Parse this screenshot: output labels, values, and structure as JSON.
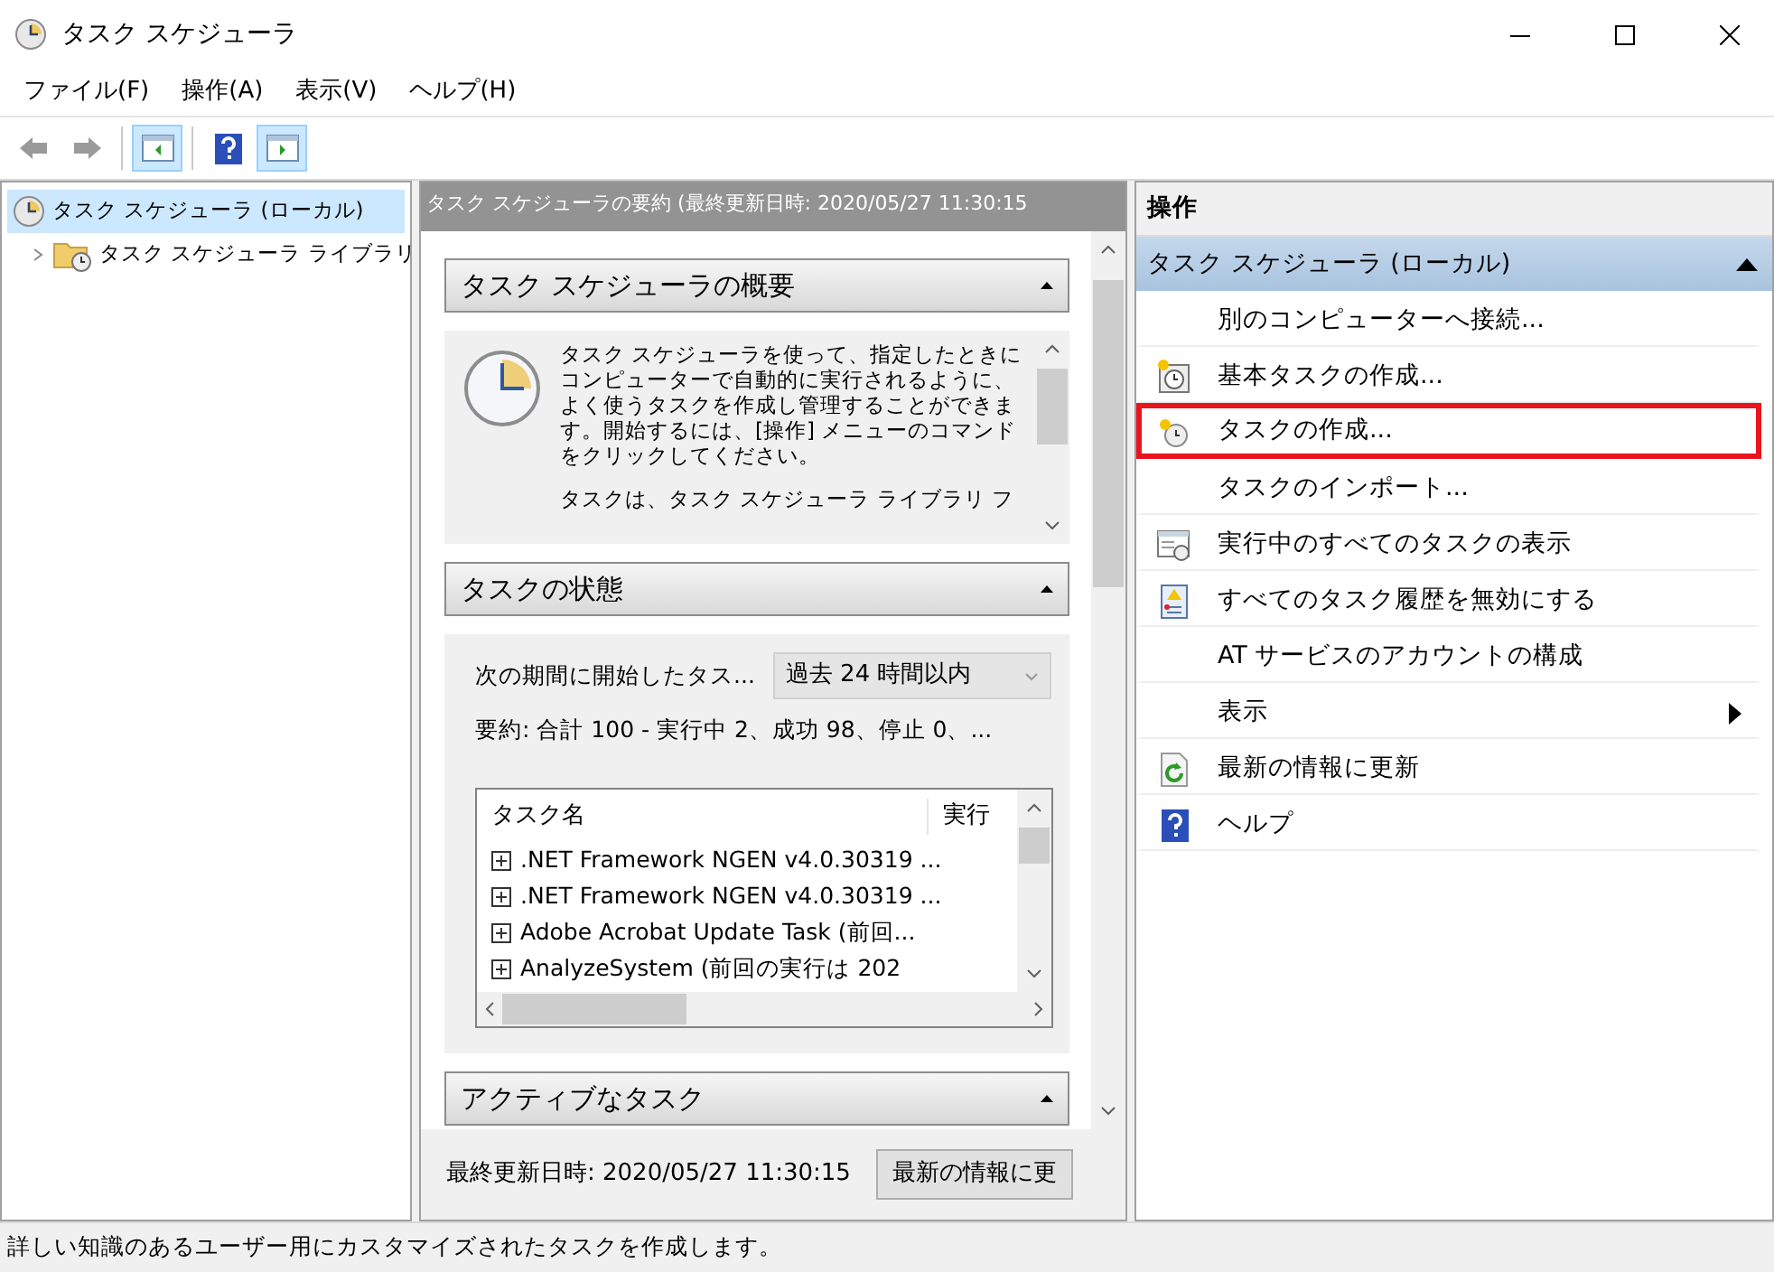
{
  "window": {
    "title": "タスク スケジューラ"
  },
  "menu": [
    {
      "label": "ファイル(F)"
    },
    {
      "label": "操作(A)"
    },
    {
      "label": "表示(V)"
    },
    {
      "label": "ヘルプ(H)"
    }
  ],
  "toolbar": [
    {
      "kind": "back",
      "disabled": true
    },
    {
      "kind": "forward",
      "disabled": true
    },
    {
      "kind": "tree-pane",
      "on": true
    },
    {
      "kind": "help",
      "on": false
    },
    {
      "kind": "action-pane",
      "on": true
    }
  ],
  "tree": [
    {
      "label": "タスク スケジューラ (ローカル)",
      "selected": true,
      "children": [
        {
          "label": "タスク スケジューラ ライブラリ",
          "selected": false,
          "expanded": false
        }
      ]
    }
  ],
  "center": {
    "header": "タスク スケジューラの要約 (最終更新日時: 2020/05/27 11:30:15",
    "sections": [
      {
        "kind": "overview",
        "title": "タスク スケジューラの概要",
        "expanded": true,
        "text": "タスク スケジューラを使って、指定したときにコンピューターで自動的に実行されるように、よく使うタスクを作成し管理することができます。開始するには、[操作] メニューのコマンドをクリックしてください。",
        "text2": "タスクは、タスク スケジューラ ライブラリ フ"
      },
      {
        "kind": "status",
        "title": "タスクの状態",
        "expanded": true,
        "filter_label": "次の期間に開始したタス...",
        "filter_value": "過去 24 時間以内",
        "summary": "要約: 合計 100 - 実行中 2、成功 98、停止 0、...",
        "table": {
          "columns": [
            "タスク名",
            "実行"
          ],
          "rows": [
            {
              "name": ".NET Framework NGEN v4.0.30319 ...",
              "expanded": false
            },
            {
              "name": ".NET Framework NGEN v4.0.30319 ...",
              "expanded": false
            },
            {
              "name": "Adobe Acrobat Update Task (前回...",
              "expanded": false
            },
            {
              "name": "AnalyzeSystem (前回の実行は 202",
              "expanded": false
            }
          ]
        }
      },
      {
        "kind": "active",
        "title": "アクティブなタスク",
        "expanded": true
      }
    ],
    "footer_text": "最終更新日時: 2020/05/27 11:30:15",
    "refresh_button": "最新の情報に更"
  },
  "actions": {
    "header": "操作",
    "group": "タスク スケジューラ (ローカル)",
    "group_expanded": true,
    "items": [
      {
        "label": "別のコンピューターへ接続...",
        "kind": "plain",
        "highlighted": false,
        "submenu": false
      },
      {
        "label": "基本タスクの作成...",
        "kind": "basic-task",
        "highlighted": false,
        "submenu": false
      },
      {
        "label": "タスクの作成...",
        "kind": "task",
        "highlighted": true,
        "submenu": false
      },
      {
        "label": "タスクのインポート...",
        "kind": "plain",
        "highlighted": false,
        "submenu": false
      },
      {
        "label": "実行中のすべてのタスクの表示",
        "kind": "running",
        "highlighted": false,
        "submenu": false
      },
      {
        "label": "すべてのタスク履歴を無効にする",
        "kind": "history",
        "highlighted": false,
        "submenu": false
      },
      {
        "label": "AT サービスのアカウントの構成",
        "kind": "plain",
        "highlighted": false,
        "submenu": false
      },
      {
        "label": "表示",
        "kind": "plain",
        "highlighted": false,
        "submenu": true
      },
      {
        "label": "最新の情報に更新",
        "kind": "refresh",
        "highlighted": false,
        "submenu": false
      },
      {
        "label": "ヘルプ",
        "kind": "help",
        "highlighted": false,
        "submenu": false
      }
    ]
  },
  "status_bar": "詳しい知識のあるユーザー用にカスタマイズされたタスクを作成します。"
}
